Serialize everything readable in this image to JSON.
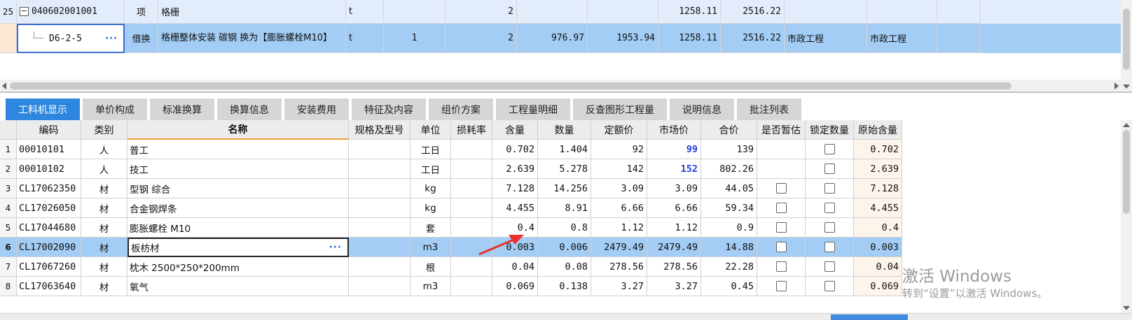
{
  "top_grid": {
    "rows": [
      {
        "row_num": "25",
        "code": "040602001001",
        "type": "项",
        "name": "格栅",
        "unit": "t",
        "c1": "",
        "c2": "2",
        "c3": "",
        "c4": "",
        "c5": "1258.11",
        "c6": "2516.22",
        "c7": "",
        "c8": ""
      },
      {
        "row_num": "",
        "code": "D6-2-5",
        "type": "借换",
        "name": "格栅整体安装 碳钢  换为【膨胀螺栓M10】",
        "unit": "t",
        "c1": "1",
        "c2": "2",
        "c3": "976.97",
        "c4": "1953.94",
        "c5": "1258.11",
        "c6": "2516.22",
        "c7": "市政工程",
        "c8": "市政工程"
      }
    ]
  },
  "tabs": [
    {
      "label": "工料机显示",
      "active": true
    },
    {
      "label": "单价构成",
      "active": false
    },
    {
      "label": "标准换算",
      "active": false
    },
    {
      "label": "换算信息",
      "active": false
    },
    {
      "label": "安装费用",
      "active": false
    },
    {
      "label": "特征及内容",
      "active": false
    },
    {
      "label": "组价方案",
      "active": false
    },
    {
      "label": "工程量明细",
      "active": false
    },
    {
      "label": "反查图形工程量",
      "active": false
    },
    {
      "label": "说明信息",
      "active": false
    },
    {
      "label": "批注列表",
      "active": false
    }
  ],
  "bottom_grid": {
    "headers": {
      "code": "编码",
      "category": "类别",
      "name": "名称",
      "spec": "规格及型号",
      "unit": "单位",
      "loss": "损耗率",
      "content": "含量",
      "qty": "数量",
      "quota_price": "定额价",
      "market_price": "市场价",
      "total": "合价",
      "estimate": "是否暂估",
      "lock_qty": "锁定数量",
      "orig_content": "原始含量"
    },
    "rows": [
      {
        "n": "1",
        "code": "00010101",
        "cat": "人",
        "name": "普工",
        "spec": "",
        "unit": "工日",
        "loss": "",
        "content": "0.702",
        "qty": "1.404",
        "quota": "92",
        "market": "99",
        "total": "139",
        "estimate": false,
        "orig": "0.702"
      },
      {
        "n": "2",
        "code": "00010102",
        "cat": "人",
        "name": "技工",
        "spec": "",
        "unit": "工日",
        "loss": "",
        "content": "2.639",
        "qty": "5.278",
        "quota": "142",
        "market": "152",
        "total": "802.26",
        "estimate": false,
        "orig": "2.639"
      },
      {
        "n": "3",
        "code": "CL17062350",
        "cat": "材",
        "name": "型钢 综合",
        "spec": "",
        "unit": "kg",
        "loss": "",
        "content": "7.128",
        "qty": "14.256",
        "quota": "3.09",
        "market": "3.09",
        "total": "44.05",
        "estimate": true,
        "orig": "7.128"
      },
      {
        "n": "4",
        "code": "CL17026050",
        "cat": "材",
        "name": "合金钢焊条",
        "spec": "",
        "unit": "kg",
        "loss": "",
        "content": "4.455",
        "qty": "8.91",
        "quota": "6.66",
        "market": "6.66",
        "total": "59.34",
        "estimate": true,
        "orig": "4.455"
      },
      {
        "n": "5",
        "code": "CL17044680",
        "cat": "材",
        "name": "膨胀螺栓 M10",
        "spec": "",
        "unit": "套",
        "loss": "",
        "content": "0.4",
        "qty": "0.8",
        "quota": "1.12",
        "market": "1.12",
        "total": "0.9",
        "estimate": true,
        "orig": "0.4"
      },
      {
        "n": "6",
        "code": "CL17002090",
        "cat": "材",
        "name": "板枋材",
        "spec": "",
        "unit": "m3",
        "loss": "",
        "content": "0.003",
        "qty": "0.006",
        "quota": "2479.49",
        "market": "2479.49",
        "total": "14.88",
        "estimate": true,
        "orig": "0.003"
      },
      {
        "n": "7",
        "code": "CL17067260",
        "cat": "材",
        "name": "枕木 2500*250*200mm",
        "spec": "",
        "unit": "根",
        "loss": "",
        "content": "0.04",
        "qty": "0.08",
        "quota": "278.56",
        "market": "278.56",
        "total": "22.28",
        "estimate": true,
        "orig": "0.04"
      },
      {
        "n": "8",
        "code": "CL17063640",
        "cat": "材",
        "name": "氧气",
        "spec": "",
        "unit": "m3",
        "loss": "",
        "content": "0.069",
        "qty": "0.138",
        "quota": "3.27",
        "market": "3.27",
        "total": "0.45",
        "estimate": true,
        "orig": "0.069"
      }
    ],
    "selected_row": 6
  },
  "watermark": {
    "line1": "激活 Windows",
    "line2": "转到“设置”以激活 Windows。"
  },
  "colors": {
    "selected_row": "#a3cdf4",
    "active_tab": "#2e86de",
    "market_highlight": "#1f3ee0",
    "arrow": "#e8322a"
  }
}
